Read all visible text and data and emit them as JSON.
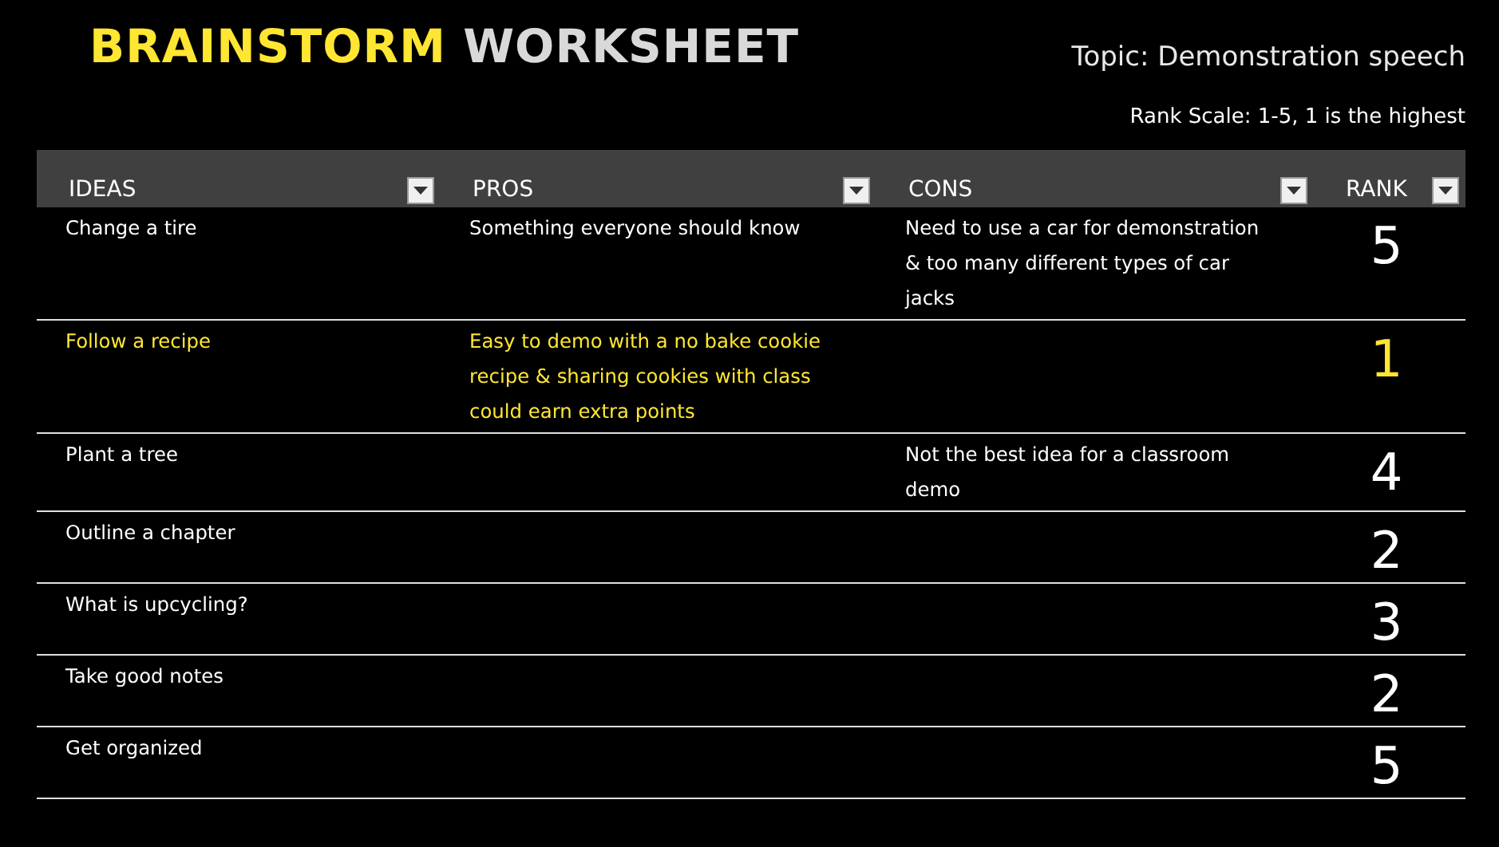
{
  "title": {
    "part_1": "BRAINSTORM",
    "part_2": "WORKSHEET"
  },
  "topic": "Topic: Demonstration speech",
  "rank_scale": "Rank Scale: 1-5, 1 is the highest",
  "table": {
    "columns": [
      "IDEAS",
      "PROS",
      "CONS",
      "RANK"
    ],
    "rows": [
      {
        "idea": "Change a tire",
        "pros": "Something everyone should know",
        "cons": "Need to use a car for demonstration & too many different types of car jacks",
        "rank": "5",
        "highlighted": false
      },
      {
        "idea": "Follow a recipe",
        "pros": "Easy to demo with a no bake cookie recipe & sharing cookies with class could earn extra points",
        "cons": "",
        "rank": "1",
        "highlighted": true
      },
      {
        "idea": "Plant a tree",
        "pros": "",
        "cons": "Not the best idea for a classroom demo",
        "rank": "4",
        "highlighted": false
      },
      {
        "idea": "Outline a chapter",
        "pros": "",
        "cons": "",
        "rank": "2",
        "highlighted": false
      },
      {
        "idea": "What is upcycling?",
        "pros": "",
        "cons": "",
        "rank": "3",
        "highlighted": false
      },
      {
        "idea": "Take good notes",
        "pros": "",
        "cons": "",
        "rank": "2",
        "highlighted": false
      },
      {
        "idea": "Get organized",
        "pros": "",
        "cons": "",
        "rank": "5",
        "highlighted": false
      }
    ]
  }
}
